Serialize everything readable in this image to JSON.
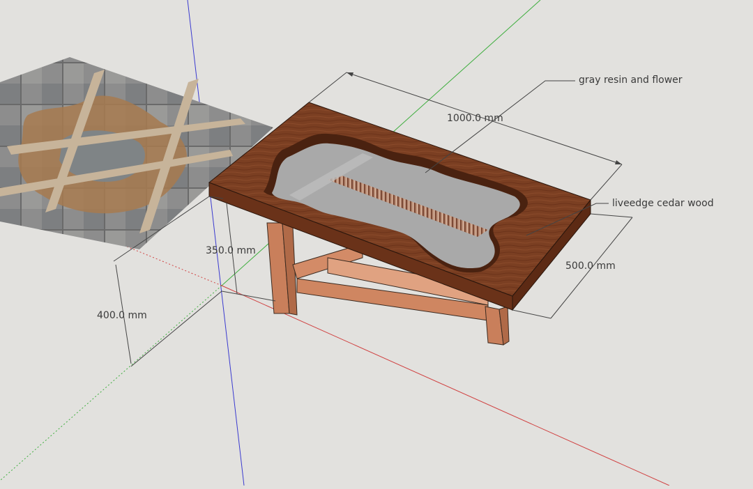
{
  "model": {
    "annotations": {
      "resin": "gray resin and flower",
      "wood": "liveedge cedar wood"
    },
    "dimensions": {
      "length": "1000.0 mm",
      "width": "500.0 mm",
      "top_height": "350.0 mm",
      "total_height": "400.0 mm"
    }
  },
  "colors": {
    "background": "#e2e1de",
    "tabletop": "#7a3e22",
    "tabletop_edge": "#6a3219",
    "leg": "#c97f5b",
    "resin": "#a9a9a9",
    "red_axis": "#d04040",
    "green_axis": "#3fae3f",
    "blue_axis": "#3a3ad0"
  }
}
